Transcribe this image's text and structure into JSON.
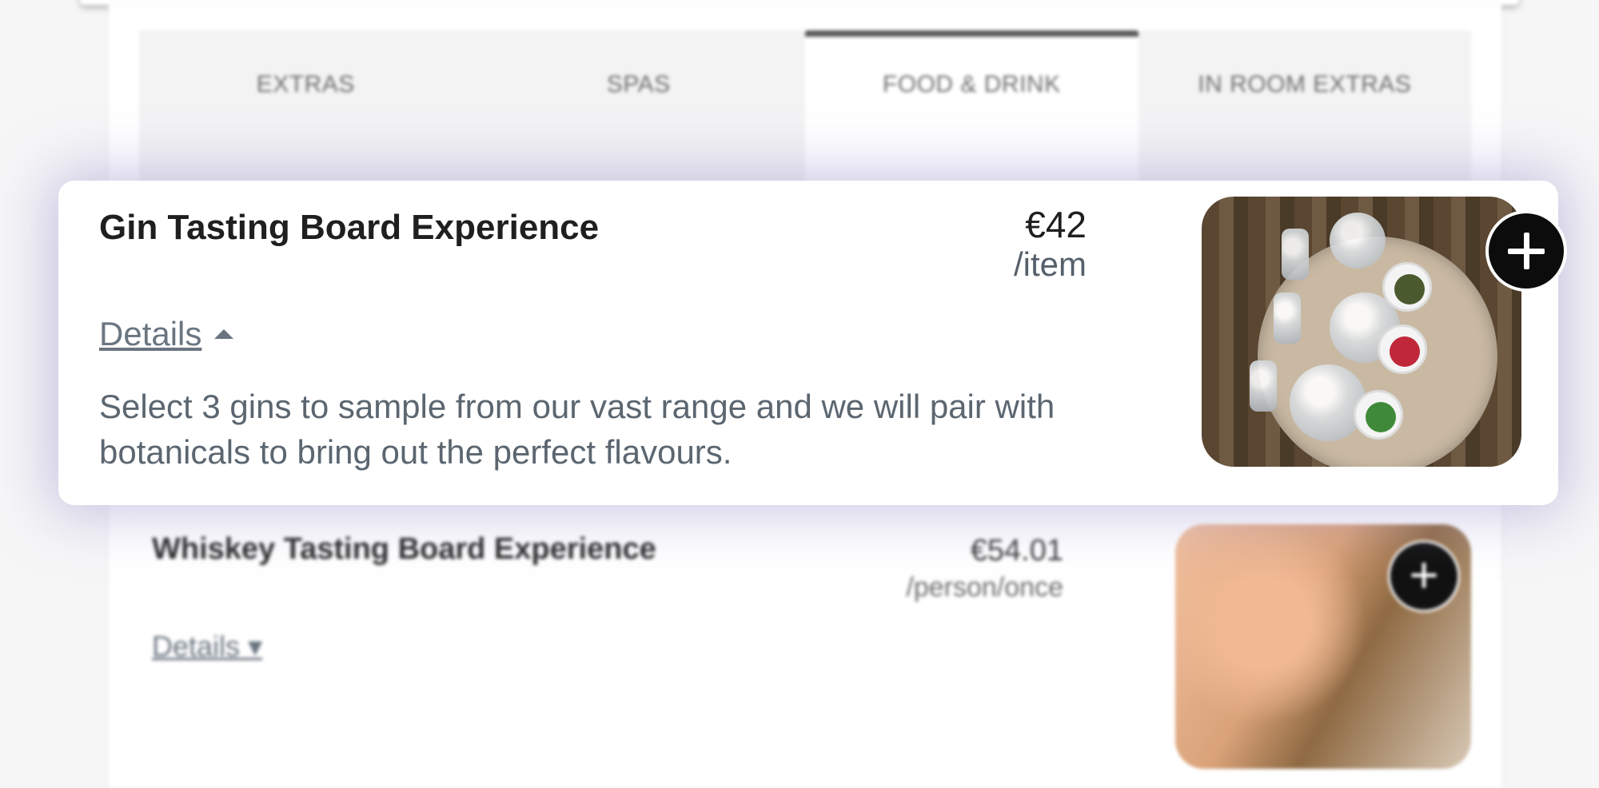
{
  "tabs": [
    {
      "label": "EXTRAS",
      "active": false
    },
    {
      "label": "SPAS",
      "active": false
    },
    {
      "label": "FOOD & DRINK",
      "active": true
    },
    {
      "label": "IN ROOM EXTRAS",
      "active": false
    }
  ],
  "featured_item": {
    "name": "Gin Tasting Board Experience",
    "price": "€42",
    "unit": "/item",
    "details_label": "Details",
    "description": "Select 3 gins to sample from our vast range and we will pair with botanicals to bring out the perfect flavours.",
    "add_icon": "plus-icon"
  },
  "next_item": {
    "name": "Whiskey Tasting Board Experience",
    "price": "€54.01",
    "unit": "/person/once",
    "details_label": "Details",
    "add_icon": "plus-icon"
  },
  "colors": {
    "active_tab_indicator": "#5a5a5a",
    "card_glow": "#a096cd",
    "add_button": "#0c0c0c"
  }
}
